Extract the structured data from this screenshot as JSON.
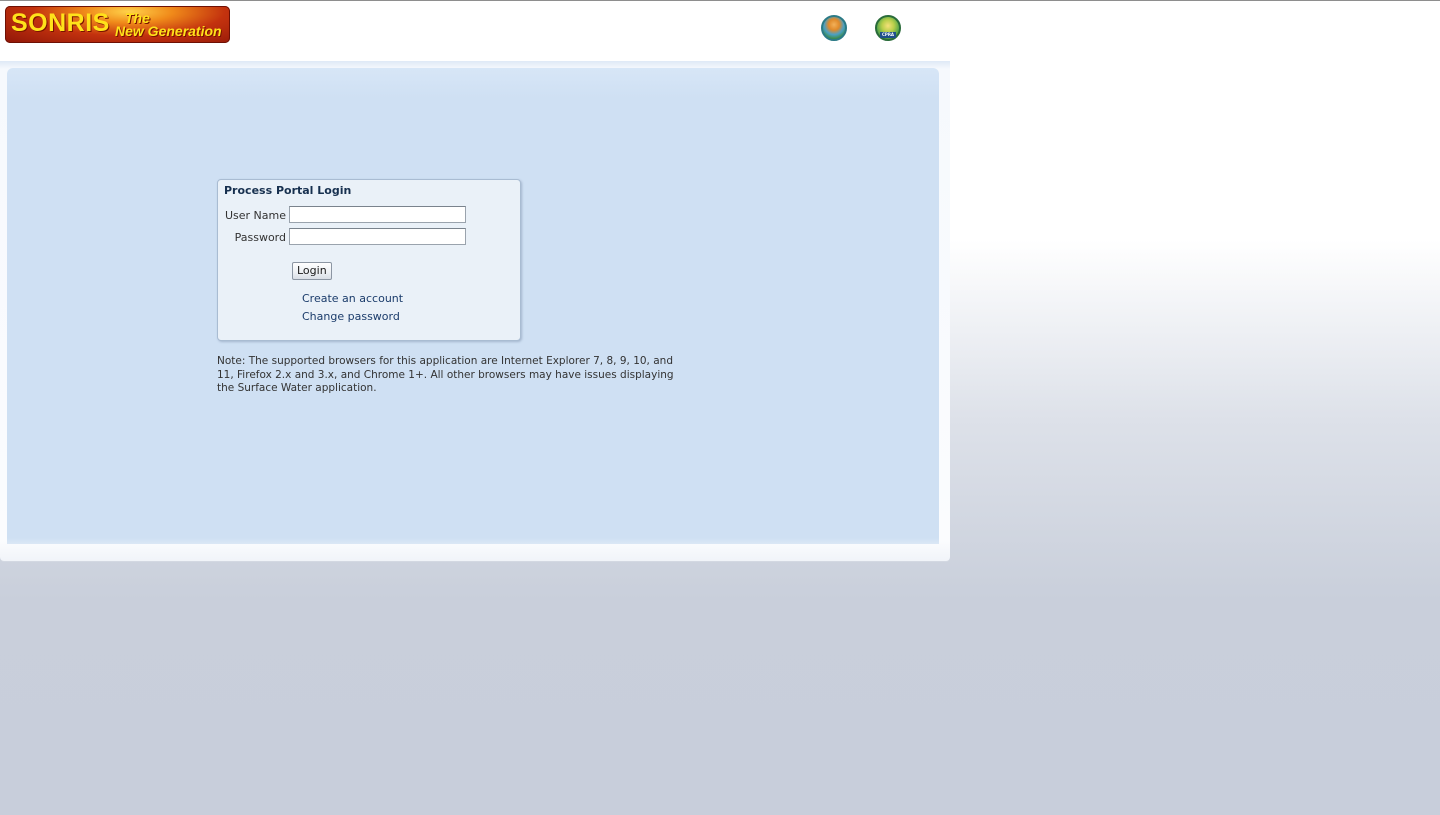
{
  "header": {
    "logo": {
      "main_text": "SONRIS",
      "sub_text_1": "The",
      "sub_text_2": "New Generation"
    },
    "seals": [
      {
        "icon": "dnr-seal-icon"
      },
      {
        "icon": "cpra-seal-icon",
        "label": "CPRA"
      }
    ]
  },
  "login": {
    "title": "Process Portal Login",
    "username_label": "User Name",
    "username_value": "",
    "password_label": "Password",
    "password_value": "",
    "login_button": "Login",
    "create_account_link": "Create an account",
    "change_password_link": "Change password"
  },
  "note": "Note: The supported browsers for this application are Internet Explorer 7, 8, 9, 10, and 11, Firefox 2.x and 3.x, and Chrome 1+. All other browsers may have issues displaying the Surface Water application.",
  "colors": {
    "logo_text": "#ffe21a",
    "logo_background": "#c3320e",
    "panel_background": "#cfe0f3",
    "login_box_background": "#eaf1f8",
    "link": "#1b3c6b"
  }
}
